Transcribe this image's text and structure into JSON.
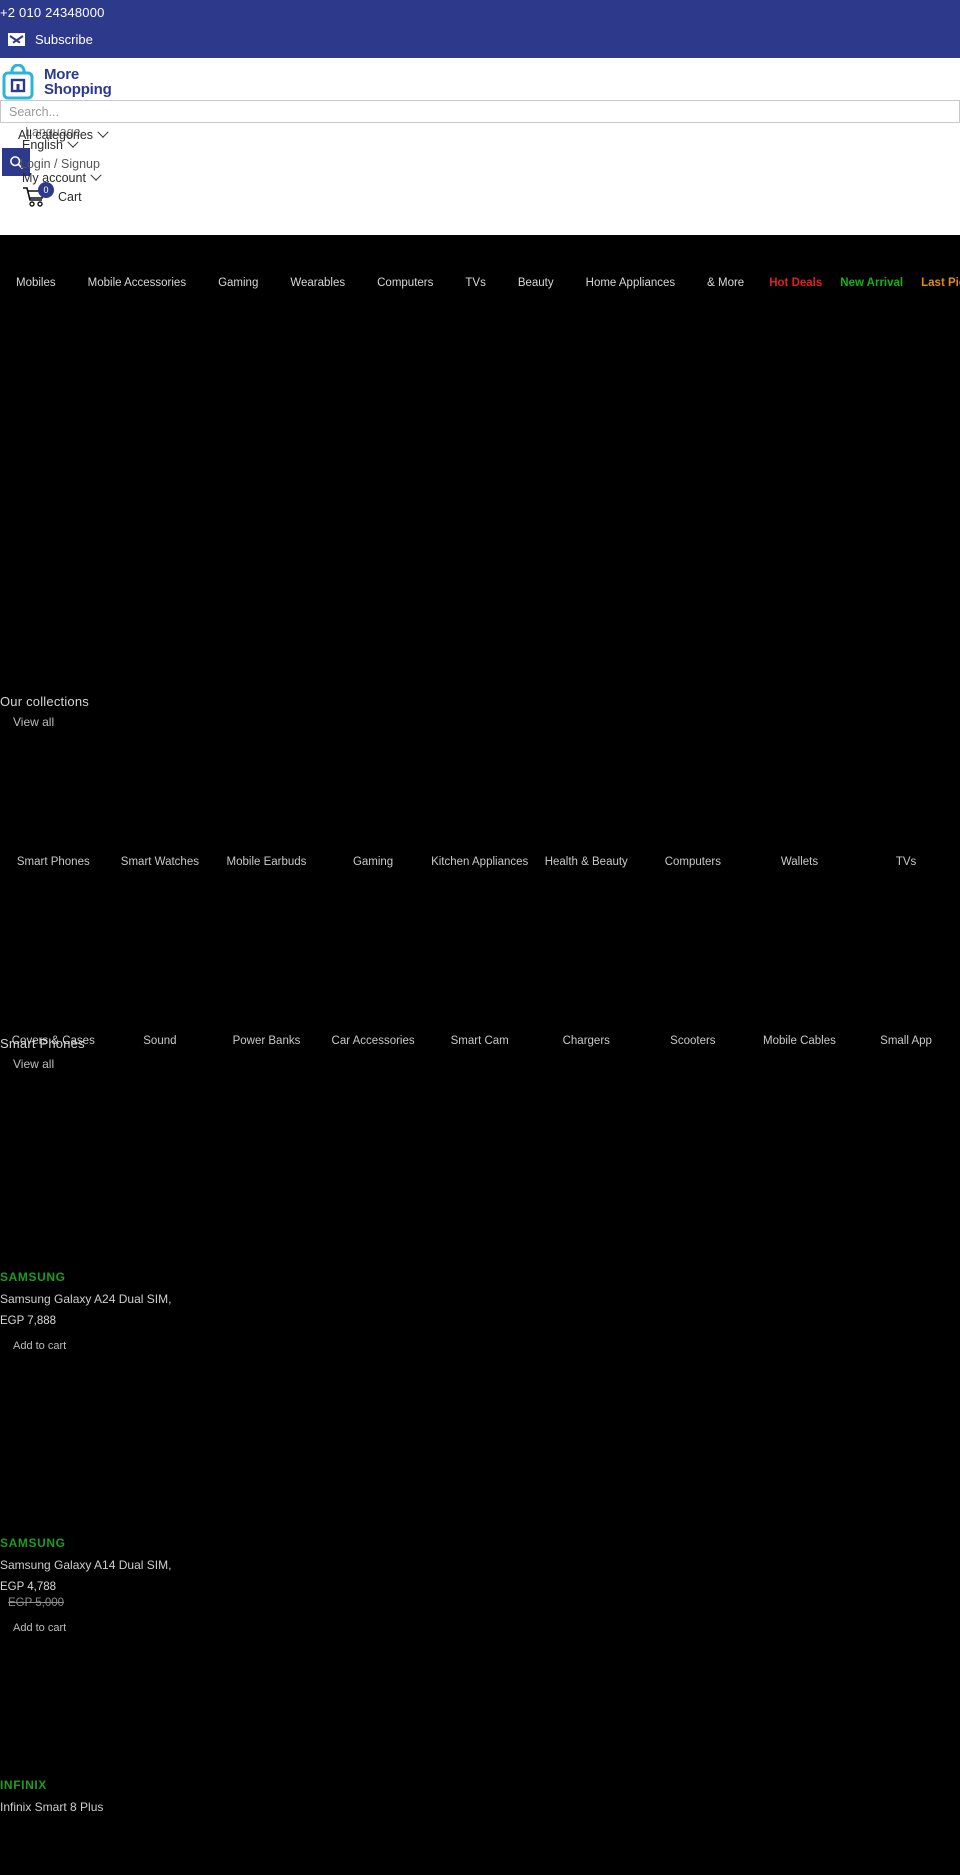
{
  "topbar": {
    "phone": "+2 010 24348000",
    "subscribe_label": "Subscribe",
    "subscribe_icon": "envelope-icon",
    "bg_color": "#2d3a8c"
  },
  "header": {
    "logo_line1": "More",
    "logo_line2": "Shopping",
    "logo_icon": "shopping-bag-icon",
    "search": {
      "placeholder": "Search...",
      "value": "",
      "button_icon": "search-icon"
    },
    "all_categories_label": "All categories",
    "language_label": "Language",
    "language_value": "English",
    "login_label": "Login / Signup",
    "my_account_label": "My account",
    "cart_label": "Cart",
    "cart_count": "0",
    "cart_icon": "shopping-cart-icon",
    "chevron_icon": "chevron-down-icon"
  },
  "nav": {
    "items": [
      {
        "label": "Mobiles",
        "style": "normal"
      },
      {
        "label": "Mobile Accessories",
        "style": "normal"
      },
      {
        "label": "Gaming",
        "style": "normal"
      },
      {
        "label": "Wearables",
        "style": "normal"
      },
      {
        "label": "Computers",
        "style": "normal"
      },
      {
        "label": "TVs",
        "style": "normal"
      },
      {
        "label": "Beauty",
        "style": "normal"
      },
      {
        "label": "Home Appliances",
        "style": "normal"
      },
      {
        "label": "& More",
        "style": "normal"
      },
      {
        "label": "Hot Deals",
        "style": "hot"
      },
      {
        "label": "New Arrival",
        "style": "new"
      },
      {
        "label": "Last Piece",
        "style": "last"
      }
    ],
    "colors": {
      "hot": "#e02020",
      "new": "#12b312",
      "last": "#e08a1e"
    }
  },
  "collections": {
    "title": "Our collections",
    "view_all": "View all",
    "row1": [
      "Smart Phones",
      "Smart Watches",
      "Mobile Earbuds",
      "Gaming",
      "Kitchen Appliances",
      "Health & Beauty",
      "Computers",
      "Wallets",
      "TVs"
    ],
    "row2": [
      "Covers & Cases",
      "Sound",
      "Power Banks",
      "Car Accessories",
      "Smart Cam",
      "Chargers",
      "Scooters",
      "Mobile Cables",
      "Small App"
    ]
  },
  "smart_phones": {
    "title": "Smart Phones",
    "view_all": "View all",
    "products": [
      {
        "brand": "SAMSUNG",
        "name": "Samsung Galaxy A24 Dual SIM,",
        "price": "EGP 7,888",
        "old_price": "",
        "add_to_cart": "Add to cart"
      },
      {
        "brand": "SAMSUNG",
        "name": "Samsung Galaxy A14 Dual SIM,",
        "price": "EGP 4,788",
        "old_price": "EGP 5,000",
        "add_to_cart": "Add to cart"
      },
      {
        "brand": "INFINIX",
        "name": "Infinix Smart 8 Plus",
        "price": "",
        "old_price": "",
        "add_to_cart": ""
      }
    ]
  }
}
